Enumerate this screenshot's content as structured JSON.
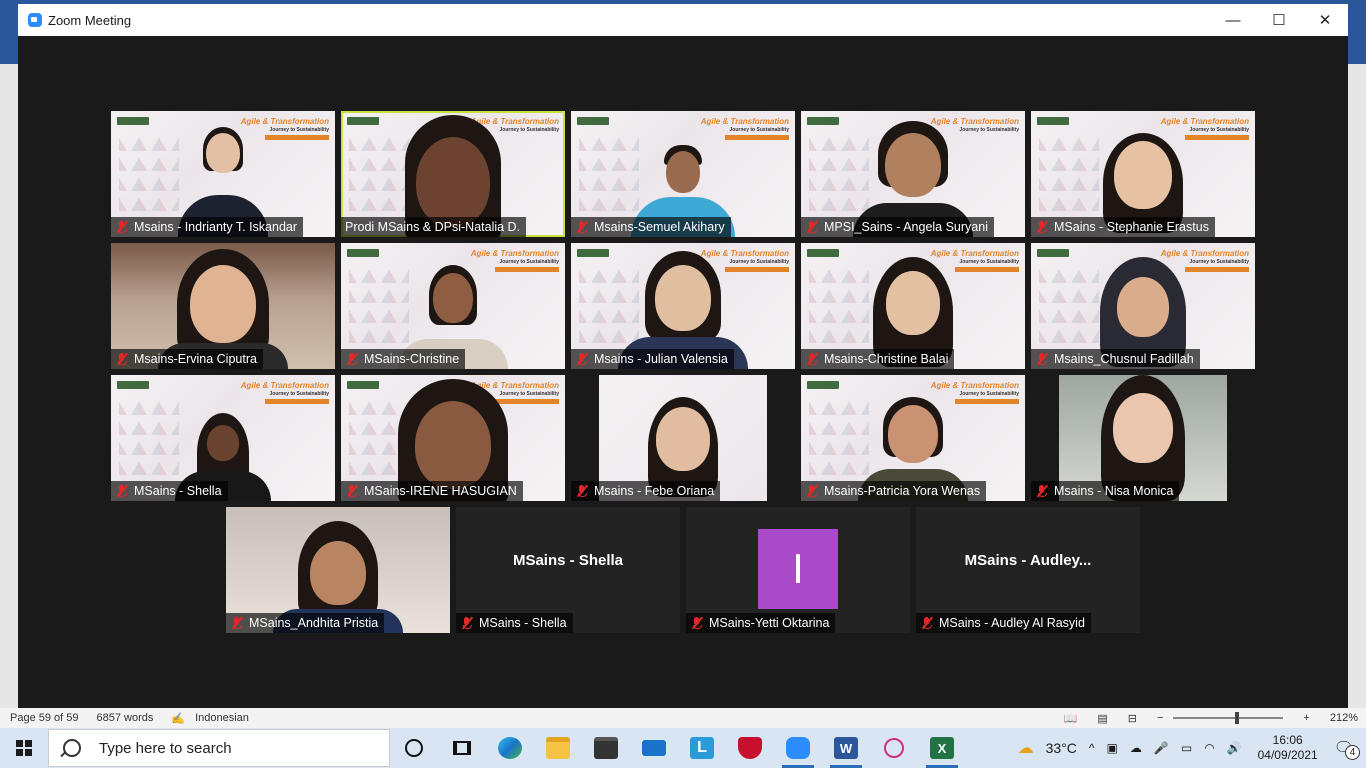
{
  "window": {
    "title": "Zoom Meeting",
    "minimize": "—",
    "maximize": "☐",
    "close": "✕"
  },
  "participants": [
    {
      "name": "Msains - Indrianty T. Iskandar"
    },
    {
      "name": "Prodi MSains & DPsi-Natalia D."
    },
    {
      "name": "Msains-Semuel Akihary"
    },
    {
      "name": "MPSI_Sains - Angela Suryani"
    },
    {
      "name": "MSains - Stephanie Erastus"
    },
    {
      "name": "Msains-Ervina Ciputra"
    },
    {
      "name": "MSains-Christine"
    },
    {
      "name": "Msains - Julian Valensia"
    },
    {
      "name": "Msains-Christine Balai"
    },
    {
      "name": "Msains_Chusnul Fadillah"
    },
    {
      "name": "MSains - Shella"
    },
    {
      "name": "MSains-IRENE HASUGIAN"
    },
    {
      "name": "Msains - Febe Oriana"
    },
    {
      "name": "Msains-Patricia Yora Wenas"
    },
    {
      "name": "Msains - Nisa Monica"
    },
    {
      "name": "MSains_Andhita Pristia"
    },
    {
      "name": "MSains - Shella",
      "center": "MSains - Shella"
    },
    {
      "name": "MSains-Yetti Oktarina",
      "avatar": "I"
    },
    {
      "name": "MSains - Audley Al Rasyid",
      "center": "MSains  -  Audley..."
    }
  ],
  "slide": {
    "agile": "Agile & Transformation",
    "journey": "Journey to Sustainability"
  },
  "statusbar": {
    "page": "Page 59 of 59",
    "words": "6857 words",
    "language": "Indonesian",
    "zoom": "212%"
  },
  "taskbar": {
    "search_placeholder": "Type here to search",
    "weather": "33°C",
    "time": "16:06",
    "date": "04/09/2021",
    "notifications": "4"
  }
}
